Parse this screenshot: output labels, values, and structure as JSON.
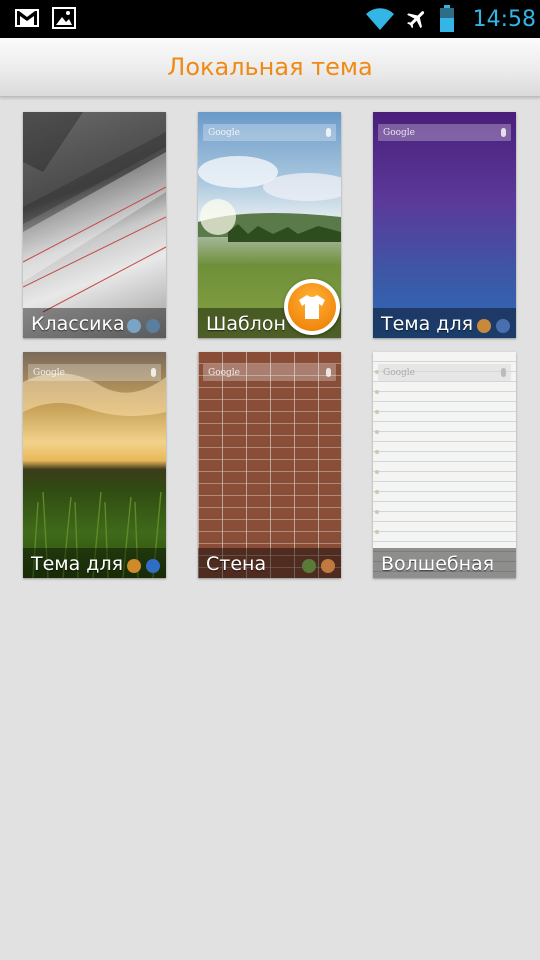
{
  "status_bar": {
    "time": "14:58",
    "notification_icons": [
      "gmail-icon",
      "gallery-image-icon"
    ],
    "system_icons": [
      "wifi-icon",
      "airplane-mode-icon",
      "battery-icon"
    ],
    "accent_color": "#33b5e5"
  },
  "header": {
    "title": "Локальная тема",
    "title_color": "#f08a14"
  },
  "themes": [
    {
      "name": "Классика",
      "wallpaper": "gray-metal-architecture"
    },
    {
      "name": "Шаблон",
      "wallpaper": "green-meadow-sky",
      "applied": true,
      "badge_icon": "tshirt-icon"
    },
    {
      "name": "Тема для",
      "wallpaper": "purple-blue-gradient"
    },
    {
      "name": "Тема для",
      "wallpaper": "sunset-grass-field"
    },
    {
      "name": "Стена",
      "wallpaper": "red-brick-wall"
    },
    {
      "name": "Волшебная",
      "wallpaper": "lined-notebook-paper"
    }
  ],
  "search_bar_brand": "Google",
  "background_color": "#e1e1e1"
}
